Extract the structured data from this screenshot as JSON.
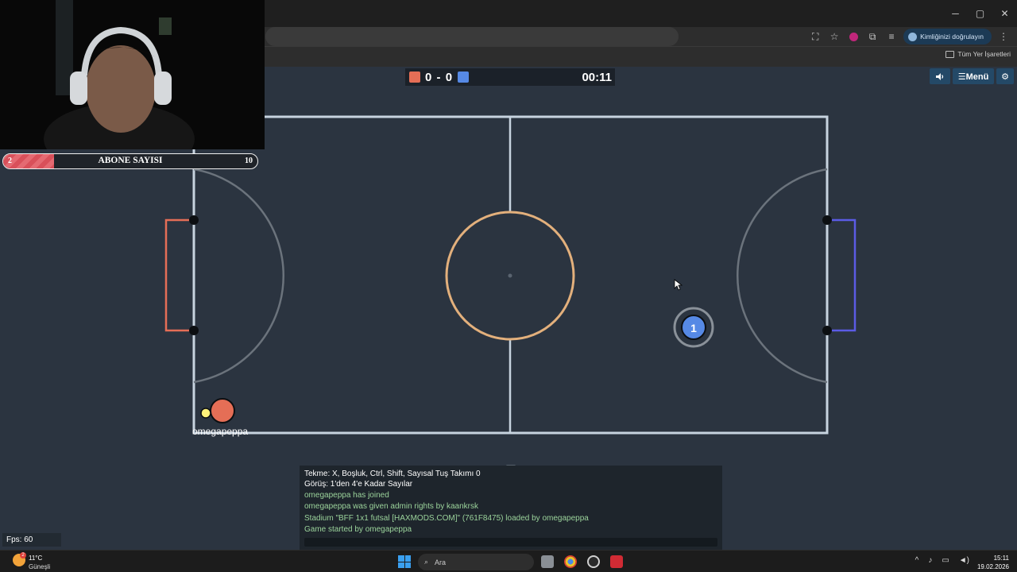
{
  "browser": {
    "verify_label": "Kimliğinizi doğrulayın",
    "bookmarks_label": "Tüm Yer İşaretleri",
    "window_controls": [
      "─",
      "▢",
      "✕"
    ]
  },
  "scoreboard": {
    "red_score": "0",
    "separator": "-",
    "blue_score": "0",
    "time": "00:11",
    "red_color": "#e56e56",
    "blue_color": "#5689e5"
  },
  "game_buttons": {
    "sound_icon": "speaker-icon",
    "menu_label": "☰Menü",
    "settings_icon": "gear-icon"
  },
  "players": {
    "red_player_name": "omegapeppa",
    "blue_player_number": "1"
  },
  "subscriber_bar": {
    "current": "2",
    "label": "ABONE SAYISI",
    "goal": "10",
    "progress_fraction": 0.2
  },
  "chat": {
    "lines": [
      {
        "text": "Tekme: X, Boşluk, Ctrl, Shift, Sayısal Tuş Takımı 0",
        "type": "sys"
      },
      {
        "text": "Görüş: 1'den 4'e Kadar Sayılar",
        "type": "sys"
      },
      {
        "text": "omegapeppa has joined",
        "type": "notice"
      },
      {
        "text": "omegapeppa was given admin rights by kaankrsk",
        "type": "notice"
      },
      {
        "text": "Stadium \"BFF 1x1 futsal [HAXMODS.COM]\" (761F8475) loaded by omegapeppa",
        "type": "notice"
      },
      {
        "text": "Game started by omegapeppa",
        "type": "notice"
      }
    ]
  },
  "fps": {
    "label": "Fps: 60"
  },
  "taskbar": {
    "weather_temp": "11°C",
    "weather_desc": "Güneşli",
    "weather_badge": "2",
    "search_placeholder": "Ara",
    "clock_time": "15:11",
    "clock_date": "19.02.2026"
  }
}
